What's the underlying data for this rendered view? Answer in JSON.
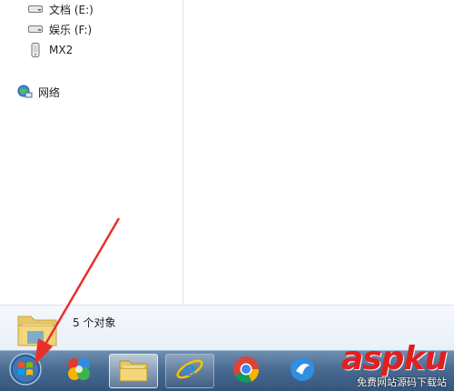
{
  "nav": {
    "items": [
      {
        "label": "文档 (E:)",
        "icon": "drive-icon"
      },
      {
        "label": "娱乐 (F:)",
        "icon": "drive-icon"
      },
      {
        "label": "MX2",
        "icon": "portable-device-icon"
      },
      {
        "label": "网络",
        "icon": "network-icon"
      }
    ]
  },
  "details": {
    "count_text": "5 个对象"
  },
  "taskbar": {
    "buttons": [
      {
        "name": "start-button",
        "icon": "windows-logo-icon"
      },
      {
        "name": "app-360-button",
        "icon": "app-360-icon"
      },
      {
        "name": "explorer-button",
        "icon": "folder-icon",
        "active": true
      },
      {
        "name": "ie-button",
        "icon": "ie-icon"
      },
      {
        "name": "chrome-button",
        "icon": "chrome-icon"
      },
      {
        "name": "app-button",
        "icon": "app-icon"
      }
    ]
  },
  "watermark": {
    "logo": "aspku",
    "sub": "免费网站源码下载站"
  },
  "colors": {
    "accent": "#e02020",
    "taskbar": "#4a6b91"
  }
}
